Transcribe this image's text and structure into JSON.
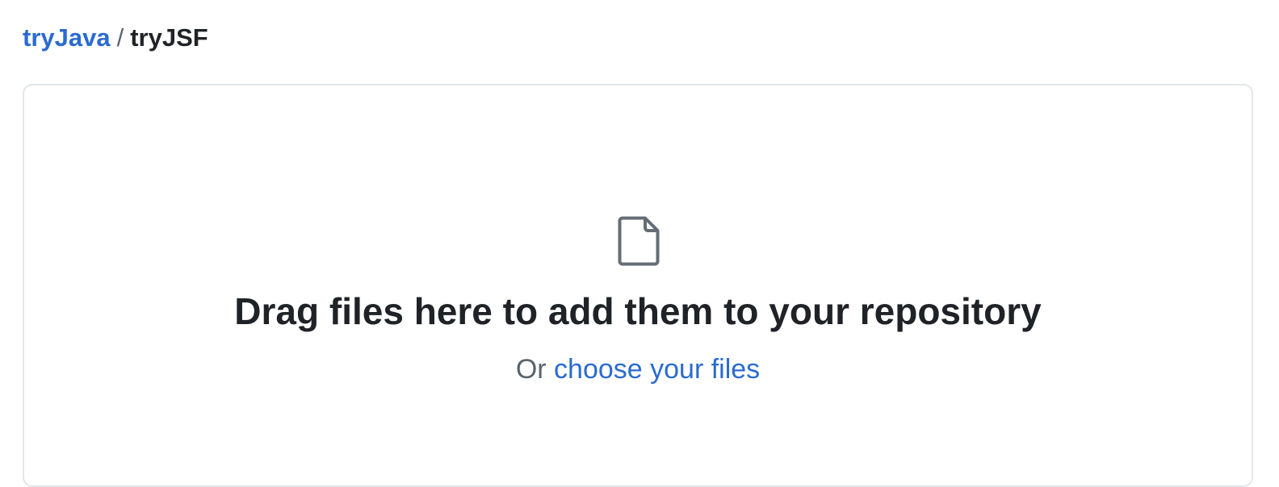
{
  "breadcrumb": {
    "owner": "tryJava",
    "separator": "/",
    "repo": "tryJSF"
  },
  "dropzone": {
    "icon": "file-icon",
    "title": "Drag files here to add them to your repository",
    "sub_prefix": "Or",
    "choose_link": "choose your files"
  },
  "colors": {
    "link": "#2a6bd0",
    "text": "#1f2328",
    "muted": "#59636e",
    "border": "#e3e6ea"
  }
}
